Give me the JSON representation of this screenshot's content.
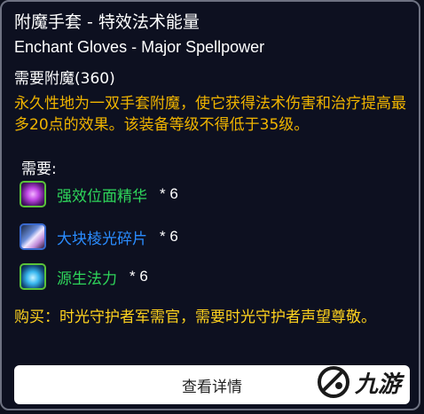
{
  "item": {
    "title": "附魔手套 - 特效法术能量",
    "subtitle": "Enchant Gloves - Major Spellpower",
    "requirement": "需要附魔(360)",
    "description": "永久性地为一双手套附魔，使它获得法术伤害和治疗提高最多20点的效果。该装备等级不得低于35级。"
  },
  "materials": {
    "label": "需要:",
    "items": [
      {
        "name": "强效位面精华",
        "qty": "* 6",
        "icon": "essence-icon"
      },
      {
        "name": "大块棱光碎片",
        "qty": "* 6",
        "icon": "prismatic-shard-icon"
      },
      {
        "name": "源生法力",
        "qty": "* 6",
        "icon": "primal-mana-icon"
      }
    ]
  },
  "purchase": "购买：时光守护者军需官，需要时光守护者声望尊敬。",
  "button": {
    "label": "查看详情"
  },
  "watermark": {
    "text": "九游"
  },
  "colors": {
    "description": "#f0b400",
    "purchase": "#ffd21e",
    "rare": "#2a8cff",
    "uncommon": "#2ed55a"
  }
}
